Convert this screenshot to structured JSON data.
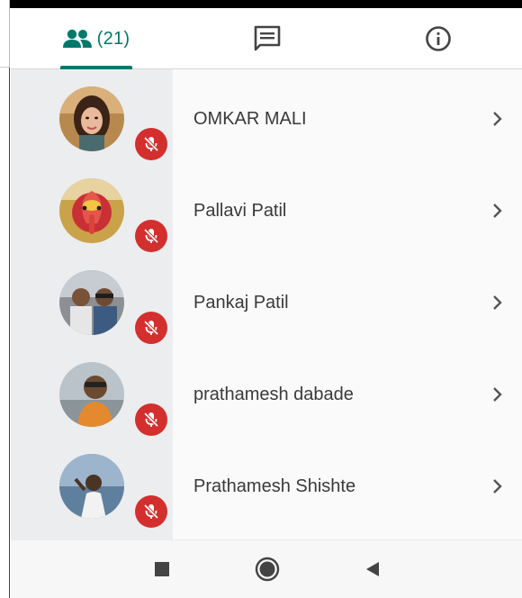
{
  "tabs": {
    "participants_count": "(21)",
    "active": "participants",
    "accent_color": "#00796b",
    "items": [
      {
        "id": "participants",
        "icon": "people-icon"
      },
      {
        "id": "chat",
        "icon": "chat-message-icon"
      },
      {
        "id": "info",
        "icon": "info-icon"
      }
    ]
  },
  "participants": [
    {
      "name": "OMKAR MALI",
      "muted": true,
      "avatar": "profile-photo"
    },
    {
      "name": "Pallavi Patil",
      "muted": true,
      "avatar": "profile-photo"
    },
    {
      "name": "Pankaj Patil",
      "muted": true,
      "avatar": "profile-photo"
    },
    {
      "name": "prathamesh dabade",
      "muted": true,
      "avatar": "profile-photo"
    },
    {
      "name": "Prathamesh Shishte",
      "muted": true,
      "avatar": "profile-photo"
    }
  ],
  "colors": {
    "muted_badge": "#d32f2f",
    "avatar_column": "#ebedef"
  },
  "nav": {
    "buttons": [
      "recents-square-icon",
      "home-circle-icon",
      "back-triangle-icon"
    ]
  }
}
